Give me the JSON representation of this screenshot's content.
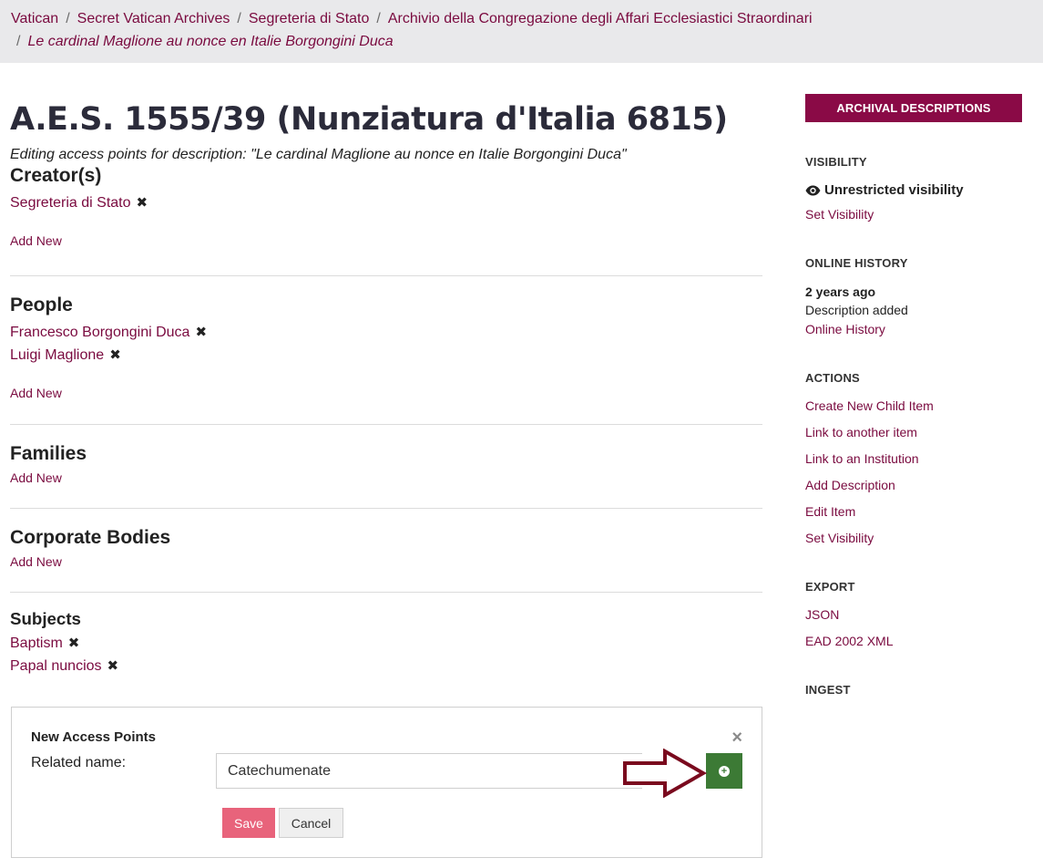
{
  "breadcrumb": {
    "items": [
      "Vatican",
      "Secret Vatican Archives",
      "Segreteria di Stato",
      "Archivio della Congregazione degli Affari Ecclesiastici Straordinari"
    ],
    "current": "Le cardinal Maglione au nonce en Italie Borgongini Duca",
    "separator": "/"
  },
  "main": {
    "title": "A.E.S. 1555/39 (Nunziatura d'Italia 6815)",
    "subtitle": "Editing access points for description: \"Le cardinal Maglione au nonce en Italie Borgongini Duca\"",
    "sections": {
      "creators": {
        "heading": "Creator(s)",
        "items": [
          "Segreteria di Stato"
        ],
        "add_label": "Add New"
      },
      "people": {
        "heading": "People",
        "items": [
          "Francesco Borgongini Duca",
          "Luigi Maglione"
        ],
        "add_label": "Add New"
      },
      "families": {
        "heading": "Families",
        "items": [],
        "add_label": "Add New"
      },
      "corporate": {
        "heading": "Corporate Bodies",
        "items": [],
        "add_label": "Add New"
      },
      "subjects": {
        "heading": "Subjects",
        "items": [
          "Baptism",
          "Papal nuncios"
        ]
      }
    },
    "remove_glyph": "✖"
  },
  "panel": {
    "title": "New Access Points",
    "close_glyph": "×",
    "field_label": "Related name:",
    "field_value": "Catechumenate",
    "add_glyph": "+",
    "save_label": "Save",
    "cancel_label": "Cancel"
  },
  "sidebar": {
    "button_label": "ARCHIVAL DESCRIPTIONS",
    "visibility": {
      "heading": "VISIBILITY",
      "status": "Unrestricted visibility",
      "link": "Set Visibility"
    },
    "history": {
      "heading": "ONLINE HISTORY",
      "when": "2 years ago",
      "what": "Description added",
      "link": "Online History"
    },
    "actions": {
      "heading": "ACTIONS",
      "items": [
        "Create New Child Item",
        "Link to another item",
        "Link to an Institution",
        "Add Description",
        "Edit Item",
        "Set Visibility"
      ]
    },
    "export": {
      "heading": "EXPORT",
      "items": [
        "JSON",
        "EAD 2002 XML"
      ]
    },
    "ingest": {
      "heading": "INGEST"
    }
  },
  "colors": {
    "brand": "#8a0a46",
    "link": "#7a0a3f",
    "add_button": "#3c7a35",
    "save_button": "#e8637b",
    "arrow": "#7a0a1e",
    "breadcrumb_bg": "#e9e9eb"
  },
  "icons": {
    "visibility": "eye-icon",
    "remove": "remove-x-icon",
    "close": "close-icon",
    "add": "plus-circle-icon",
    "annotation": "annotation-arrow-icon"
  }
}
